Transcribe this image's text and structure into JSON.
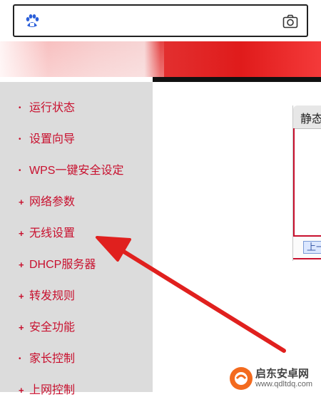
{
  "search_bar": {
    "logo_icon": "baidu-paw-icon",
    "camera_icon": "camera-icon"
  },
  "colors": {
    "accent_red": "#c8102e",
    "sidebar_bg": "#dcdcdc",
    "arrow_red": "#e0201e"
  },
  "sidebar": {
    "items": [
      {
        "label": "运行状态",
        "bullet": "•"
      },
      {
        "label": "设置向导",
        "bullet": "•"
      },
      {
        "label": "WPS一键安全设定",
        "bullet": "•"
      },
      {
        "label": "网络参数",
        "bullet": "+"
      },
      {
        "label": "无线设置",
        "bullet": "+"
      },
      {
        "label": "DHCP服务器",
        "bullet": "+"
      },
      {
        "label": "转发规则",
        "bullet": "+"
      },
      {
        "label": "安全功能",
        "bullet": "+"
      },
      {
        "label": "家长控制",
        "bullet": "•"
      },
      {
        "label": "上网控制",
        "bullet": "+"
      }
    ]
  },
  "content": {
    "tab_title": "静态",
    "prev_button_label": "上一"
  },
  "watermark": {
    "name": "启东安卓网",
    "url": "www.qdltdq.com"
  }
}
